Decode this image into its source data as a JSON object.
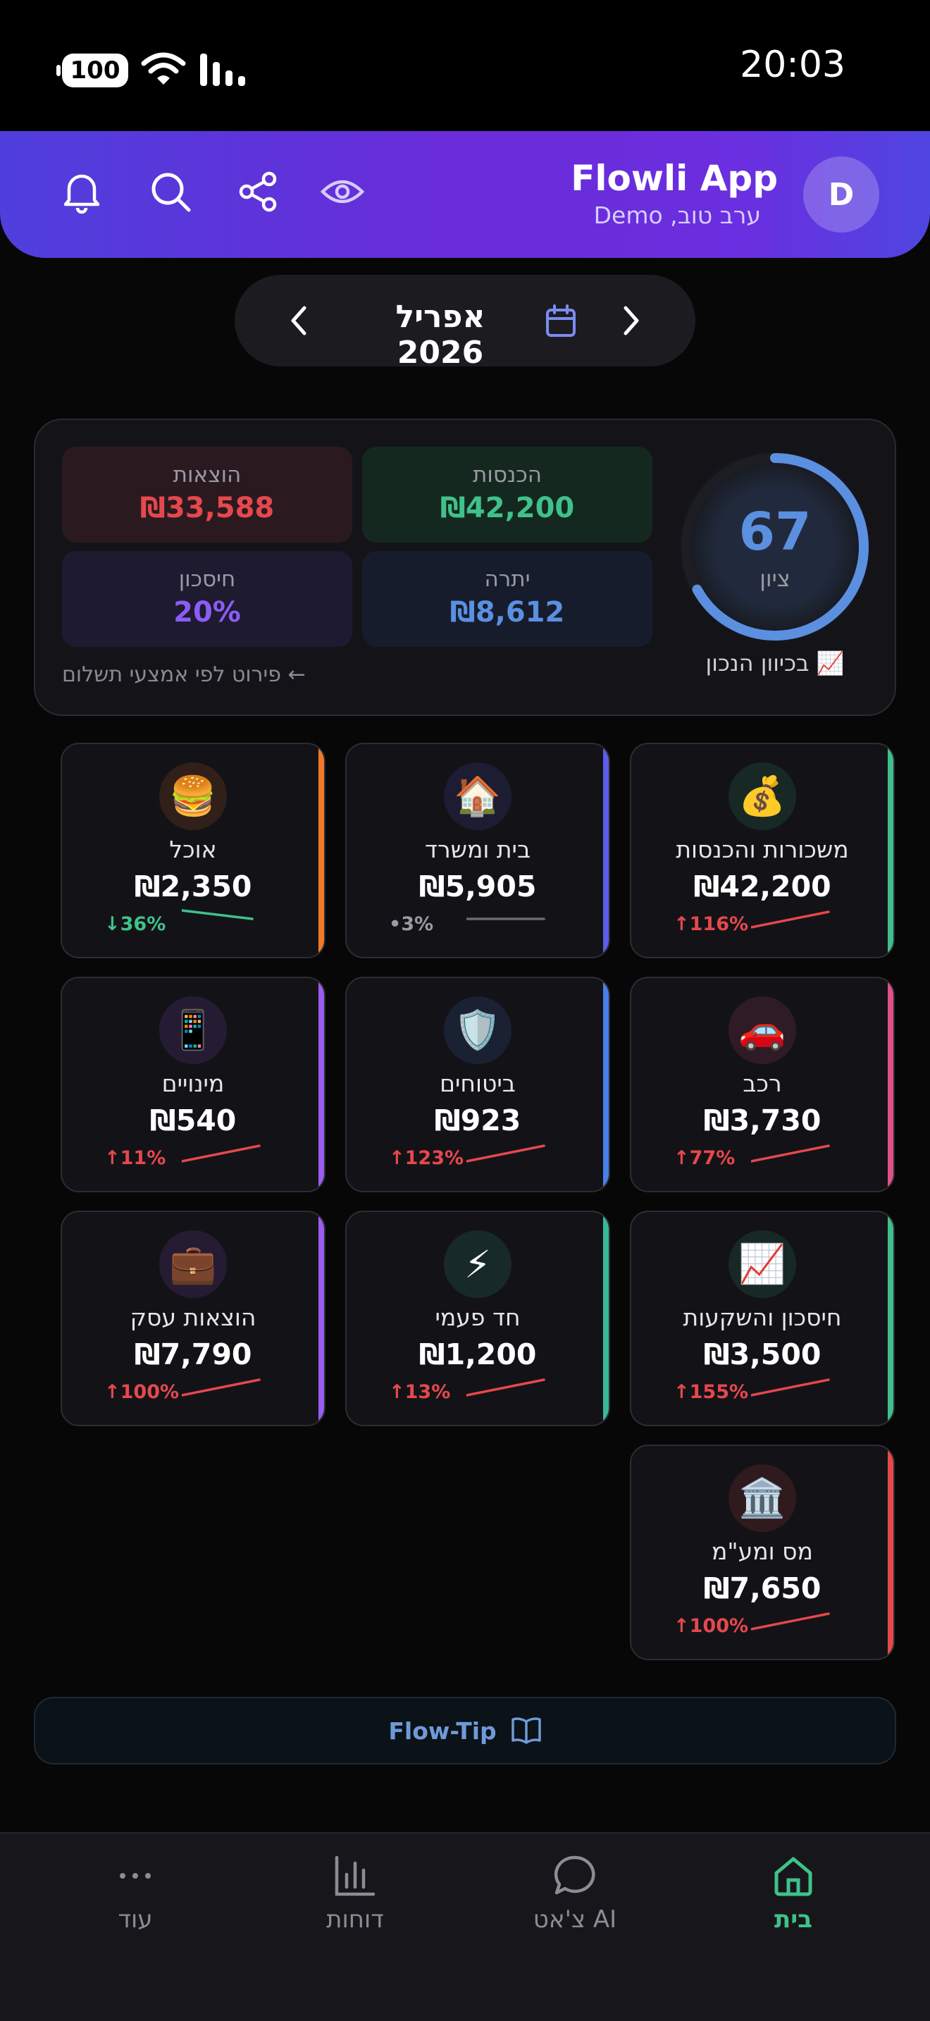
{
  "status_bar": {
    "battery": "100",
    "time": "20:03"
  },
  "header": {
    "app_title": "Flowli App",
    "greeting": "ערב טוב, Demo",
    "avatar_initial": "D",
    "icons": [
      "bell-icon",
      "search-icon",
      "share-icon",
      "eye-icon"
    ]
  },
  "month_selector": {
    "label": "אפריל 2026"
  },
  "summary": {
    "expenses": {
      "label": "הוצאות",
      "value": "₪33,588",
      "color": "#e5484d"
    },
    "income": {
      "label": "הכנסות",
      "value": "₪42,200",
      "color": "#3fc28a"
    },
    "savings": {
      "label": "חיסכון",
      "value": "20%",
      "color": "#8b5cf6"
    },
    "surplus": {
      "label": "יתרה",
      "value": "₪8,612",
      "color": "#5b8fe0"
    },
    "payment_link": "← פירוט לפי אמצעי תשלום",
    "score": {
      "value": "67",
      "max": 100,
      "label": "ציון",
      "status": "📈 בכיוון הנכון",
      "color": "#5b8fe0"
    }
  },
  "categories": [
    {
      "name": "משכורות והכנסות",
      "amount": "₪42,200",
      "change": "↑116%",
      "icon": "💰",
      "color": "#3fbf8a",
      "trend": "up"
    },
    {
      "name": "בית ומשרד",
      "amount": "₪5,905",
      "change": "•3%",
      "icon": "🏠",
      "color": "#5b5ee8",
      "trend": "flat"
    },
    {
      "name": "אוכל",
      "amount": "₪2,350",
      "change": "↓36%",
      "icon": "🍔",
      "color": "#f07a2a",
      "trend": "down"
    },
    {
      "name": "רכב",
      "amount": "₪3,730",
      "change": "↑77%",
      "icon": "🚗",
      "color": "#e0508a",
      "trend": "up"
    },
    {
      "name": "ביטוחים",
      "amount": "₪923",
      "change": "↑123%",
      "icon": "🛡️",
      "color": "#4a7fe8",
      "trend": "up"
    },
    {
      "name": "מינויים",
      "amount": "₪540",
      "change": "↑11%",
      "icon": "📱",
      "color": "#9b5cf0",
      "trend": "up"
    },
    {
      "name": "חיסכון והשקעות",
      "amount": "₪3,500",
      "change": "↑155%",
      "icon": "📈",
      "color": "#3fbf8a",
      "trend": "up"
    },
    {
      "name": "חד פעמי",
      "amount": "₪1,200",
      "change": "↑13%",
      "icon": "⚡",
      "color": "#38b89a",
      "trend": "up"
    },
    {
      "name": "הוצאות עסק",
      "amount": "₪7,790",
      "change": "↑100%",
      "icon": "💼",
      "color": "#9b5cf0",
      "trend": "up"
    },
    {
      "name": "מס ומע\"מ",
      "amount": "₪7,650",
      "change": "↑100%",
      "icon": "🏛️",
      "color": "#e5484d",
      "trend": "up"
    }
  ],
  "flow_tip": {
    "label": "Flow-Tip"
  },
  "bottom_nav": {
    "items": [
      {
        "label": "בית",
        "icon": "home-icon",
        "active": true
      },
      {
        "label": "צ'אט AI",
        "icon": "chat-icon",
        "active": false
      },
      {
        "label": "דוחות",
        "icon": "chart-icon",
        "active": false
      },
      {
        "label": "עוד",
        "icon": "more-icon",
        "active": false
      }
    ],
    "active_color": "#3fc28a"
  }
}
